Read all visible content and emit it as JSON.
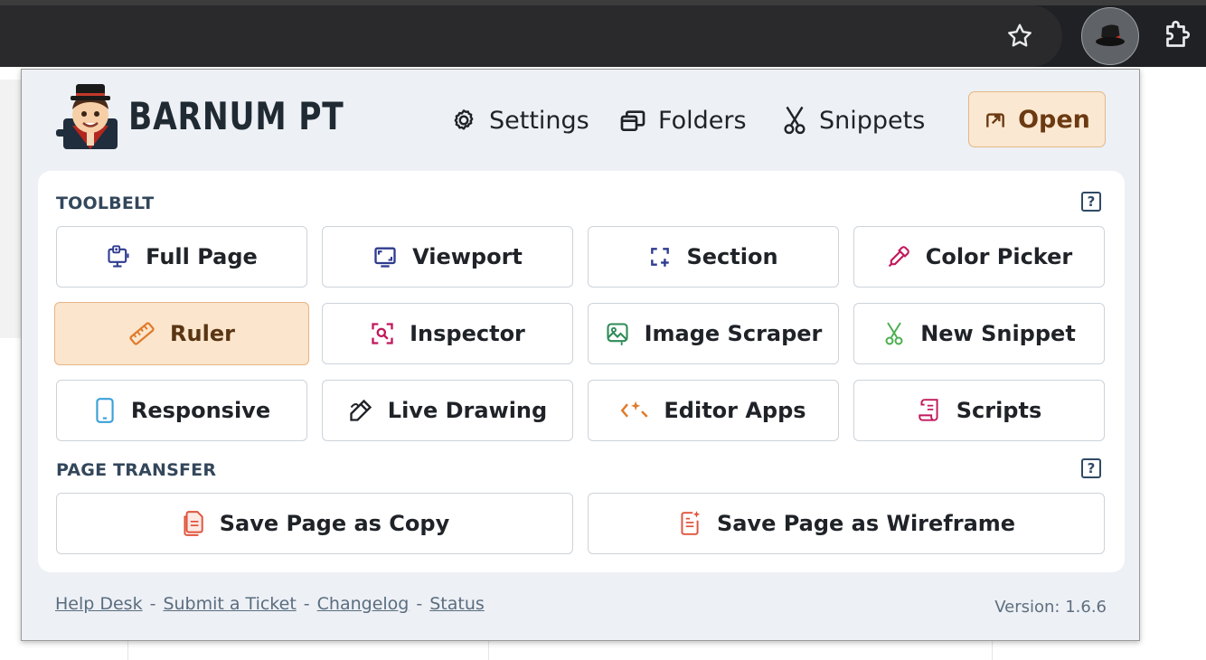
{
  "brand": {
    "name": "BARNUM PT"
  },
  "nav": {
    "settings": "Settings",
    "folders": "Folders",
    "snippets": "Snippets",
    "open": "Open"
  },
  "toolbelt": {
    "title": "TOOLBELT",
    "help": "?",
    "tools": [
      {
        "label": "Full Page",
        "icon": "screenshot-icon"
      },
      {
        "label": "Viewport",
        "icon": "viewport-icon"
      },
      {
        "label": "Section",
        "icon": "section-select-icon"
      },
      {
        "label": "Color Picker",
        "icon": "eyedropper-icon"
      },
      {
        "label": "Ruler",
        "icon": "ruler-icon",
        "active": true
      },
      {
        "label": "Inspector",
        "icon": "inspector-icon"
      },
      {
        "label": "Image Scraper",
        "icon": "image-icon"
      },
      {
        "label": "New Snippet",
        "icon": "scissors-icon"
      },
      {
        "label": "Responsive",
        "icon": "mobile-icon"
      },
      {
        "label": "Live Drawing",
        "icon": "pen-icon"
      },
      {
        "label": "Editor Apps",
        "icon": "code-icon"
      },
      {
        "label": "Scripts",
        "icon": "scroll-icon"
      }
    ]
  },
  "transfer": {
    "title": "PAGE TRANSFER",
    "help": "?",
    "save_copy": "Save Page as Copy",
    "save_wireframe": "Save Page as Wireframe"
  },
  "footer": {
    "links": [
      "Help Desk",
      "Submit a Ticket",
      "Changelog",
      "Status"
    ],
    "separator": "-",
    "version": "Version: 1.6.6"
  },
  "colors": {
    "accent": "#fbe5cd",
    "accent_border": "#e6b585",
    "heading": "#33475b"
  }
}
